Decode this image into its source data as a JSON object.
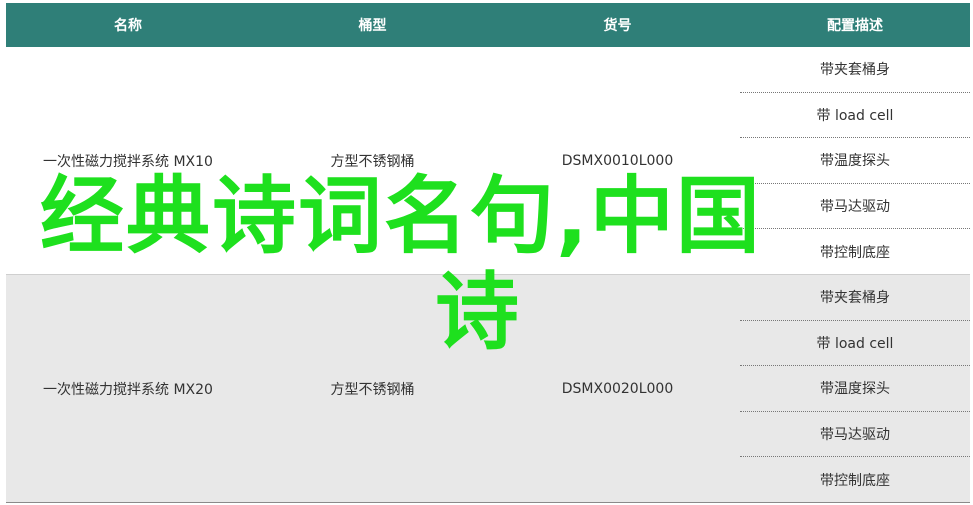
{
  "table": {
    "headers": [
      "名称",
      "桶型",
      "货号",
      "配置描述"
    ],
    "rows": [
      {
        "name": "一次性磁力搅拌系统 MX10",
        "type": "方型不锈钢桶",
        "sku": "DSMX0010L000",
        "features": [
          "带夹套桶身",
          "带 load cell",
          "带温度探头",
          "带马达驱动",
          "带控制底座"
        ]
      },
      {
        "name": "一次性磁力搅拌系统 MX20",
        "type": "方型不锈钢桶",
        "sku": "DSMX0020L000",
        "features": [
          "带夹套桶身",
          "带 load cell",
          "带温度探头",
          "带马达驱动",
          "带控制底座"
        ]
      }
    ]
  },
  "overlay": {
    "line1": "经典诗词名句,中国",
    "line2": "诗"
  },
  "colors": {
    "header_bg": "#2f7f78",
    "overlay_text": "#1ee01e",
    "alt_row_bg": "#e8e8e8"
  }
}
